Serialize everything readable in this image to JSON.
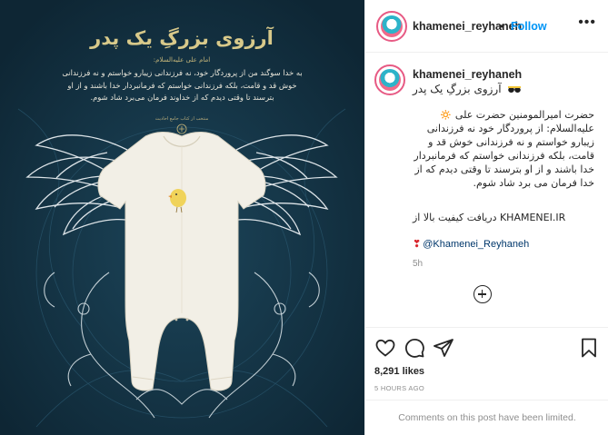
{
  "poster": {
    "title": "آرزوی بزرگِ یک پدر",
    "attribution": "امام علی علیه‌السلام:",
    "quote": "به خدا سوگند من از پروردگار خود، نه فرزندانی زیبارو خواستم و نه فرزندانی خوش قد و قامت، بلکه فرزندانی خواستم که فرمانبردار خدا باشند و از او بترسند تا وقتی دیدم که از خداوند فرمان می‌برد شاد شوم.",
    "footer": "منتخب از کتاب جامع احادیث"
  },
  "header": {
    "username": "khamenei_reyhaneh",
    "separator": "•",
    "follow_label": "Follow",
    "more_icon": "more-options-icon"
  },
  "caption": {
    "username": "khamenei_reyhaneh",
    "subtitle": "آرزوی بزرگِ یک پدر",
    "body": "حضرت امیرالمومنین حضرت علی 🔅 علیه‌السلام: از پروردگار خود نه فرزندانی زیبارو خواستم و نه فرزندانی خوش قد و قامت، بلکه فرزندانی خواستم که فرمانبردار خدا باشند و از او بترسند تا وقتی دیدم که از خدا فرمان می برد شاد شوم.",
    "link_line": "KHAMENEI.IR دریافت کیفیت بالا از",
    "heart": "❣",
    "mention": "@Khamenei_Reyhaneh",
    "time": "5h"
  },
  "actions": {
    "like_icon": "heart-icon",
    "comment_icon": "comment-icon",
    "share_icon": "share-icon",
    "save_icon": "bookmark-icon",
    "likes": "8,291 likes",
    "posted": "5 HOURS AGO"
  },
  "comments_notice": "Comments on this post have been limited.",
  "colors": {
    "poster_bg": "#123043",
    "follow": "#0095f6",
    "mention": "#00376b",
    "muted": "#8e8e8e"
  }
}
